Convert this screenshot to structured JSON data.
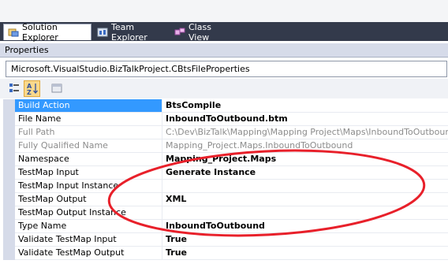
{
  "tabs": [
    {
      "label": "Solution Explorer",
      "icon": "solution-explorer-icon",
      "active": true
    },
    {
      "label": "Team Explorer",
      "icon": "team-explorer-icon",
      "active": false
    },
    {
      "label": "Class View",
      "icon": "class-view-icon",
      "active": false
    }
  ],
  "panel": {
    "title": "Properties"
  },
  "object_selector": {
    "value": "Microsoft.VisualStudio.BizTalkProject.CBtsFileProperties"
  },
  "toolbar": {
    "buttons": [
      {
        "icon": "categorized-icon",
        "checked": false
      },
      {
        "icon": "alphabetical-icon",
        "checked": true
      },
      {
        "icon": "property-pages-icon",
        "checked": false
      }
    ]
  },
  "properties": [
    {
      "name": "Build Action",
      "value": "BtsCompile",
      "bold": true,
      "readonly": false,
      "selected": true
    },
    {
      "name": "File Name",
      "value": "InboundToOutbound.btm",
      "bold": true,
      "readonly": false,
      "selected": false
    },
    {
      "name": "Full Path",
      "value": "C:\\Dev\\BizTalk\\Mapping\\Mapping Project\\Maps\\InboundToOutbound.btm",
      "bold": false,
      "readonly": true,
      "selected": false
    },
    {
      "name": "Fully Qualified Name",
      "value": "Mapping_Project.Maps.InboundToOutbound",
      "bold": false,
      "readonly": true,
      "selected": false
    },
    {
      "name": "Namespace",
      "value": "Mapping_Project.Maps",
      "bold": true,
      "readonly": false,
      "selected": false
    },
    {
      "name": "TestMap Input",
      "value": "Generate Instance",
      "bold": true,
      "readonly": false,
      "selected": false
    },
    {
      "name": "TestMap Input Instance",
      "value": "",
      "bold": false,
      "readonly": false,
      "selected": false
    },
    {
      "name": "TestMap Output",
      "value": "XML",
      "bold": true,
      "readonly": false,
      "selected": false
    },
    {
      "name": "TestMap Output Instance",
      "value": "",
      "bold": false,
      "readonly": false,
      "selected": false
    },
    {
      "name": "Type Name",
      "value": "InboundToOutbound",
      "bold": true,
      "readonly": false,
      "selected": false
    },
    {
      "name": "Validate TestMap Input",
      "value": "True",
      "bold": true,
      "readonly": false,
      "selected": false
    },
    {
      "name": "Validate TestMap Output",
      "value": "True",
      "bold": true,
      "readonly": false,
      "selected": false
    }
  ],
  "colors": {
    "annotation": "#e8202a",
    "selection": "#3399ff",
    "tabbar": "#333a4b"
  }
}
